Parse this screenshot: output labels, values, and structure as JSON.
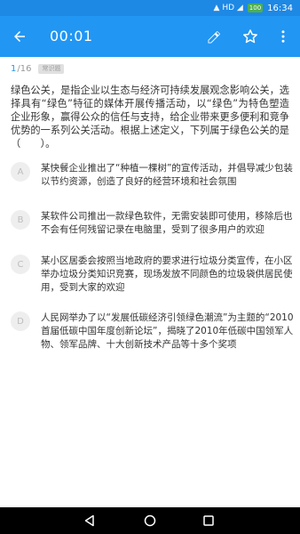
{
  "status_bar": {
    "indicators": "▲ HD ◢",
    "battery": "100",
    "time": "16:34"
  },
  "toolbar": {
    "timer": "00:01",
    "icons": [
      "back-arrow-icon",
      "edit-pencil-icon",
      "star-icon",
      "more-vert-icon"
    ]
  },
  "progress": {
    "current": "1",
    "total": "/16",
    "badge": "常识题"
  },
  "question": {
    "text": "绿色公关，是指企业以生态与经济可持续发展观念影响公关，选择具有“绿色”特征的媒体开展传播活动，以“绿色”为特色塑造企业形象，赢得公众的信任与支持，给企业带来更多便利和竞争优势的一系列公关活动。根据上述定义，下列属于绿色公关的是（　　）。"
  },
  "options": [
    {
      "letter": "A",
      "text": "某快餐企业推出了“种植一棵树”的宣传活动，并倡导减少包装以节约资源，创造了良好的经营环境和社会氛围"
    },
    {
      "letter": "B",
      "text": "某软件公司推出一款绿色软件，无需安装即可使用，移除后也不会有任何残留记录在电脑里，受到了很多用户的欢迎"
    },
    {
      "letter": "C",
      "text": "某小区居委会按照当地政府的要求进行垃圾分类宣传，在小区举办垃圾分类知识竞赛，现场发放不同颜色的垃圾袋供居民使用，受到大家的欢迎"
    },
    {
      "letter": "D",
      "text": "人民网举办了以“发展低碳经济引领绿色潮流”为主题的“2010首届低碳中国年度创新论坛”，揭晓了2010年低碳中国领军人物、领军品牌、十大创新技术产品等十多个奖项"
    }
  ],
  "colors": {
    "status_bar": "#1e88e5",
    "toolbar": "#2196f3",
    "accent": "#2196f3",
    "nav_bar": "#000000"
  }
}
